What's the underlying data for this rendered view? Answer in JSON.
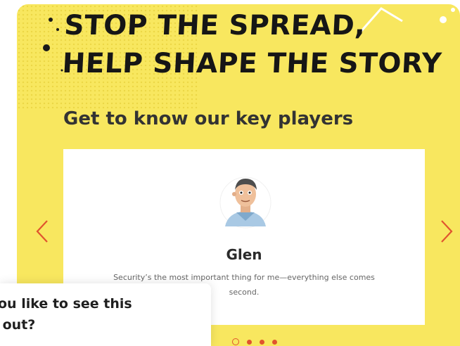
{
  "hero": {
    "headline_line1": "STOP THE SPREAD,",
    "headline_line2": "HELP SHAPE THE STORY"
  },
  "section": {
    "title": "Get to know our key players"
  },
  "carousel": {
    "current_index": 0,
    "total": 4,
    "prev_icon": "chevron-left-icon",
    "next_icon": "chevron-right-icon",
    "card": {
      "name": "Glen",
      "quote": "Security’s the most important thing for me—everything else comes second.",
      "avatar_icon": "security-guard-avatar"
    }
  },
  "survey_popup": {
    "line1": "ou like to see this",
    "line2": " out?"
  },
  "colors": {
    "panel": "#f8e75f",
    "accent": "#e0542e",
    "headline": "#161616"
  }
}
